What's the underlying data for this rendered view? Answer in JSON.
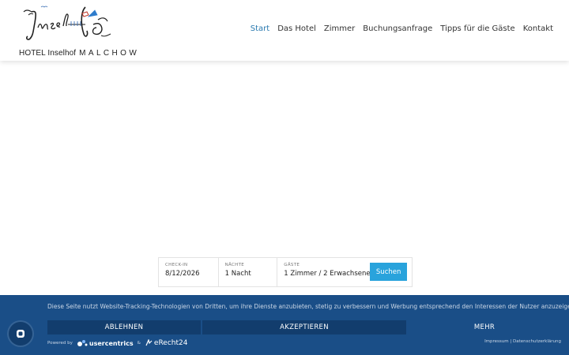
{
  "logo": {
    "script_text": "Inselhof",
    "hotel_name": "HOTEL Inselhof",
    "town": "MALCHOW"
  },
  "nav": {
    "items": [
      "Start",
      "Das Hotel",
      "Zimmer",
      "Buchungsanfrage",
      "Tipps für die Gäste",
      "Kontakt"
    ],
    "active": "Start"
  },
  "booking": {
    "checkin_label": "CHECK-IN",
    "checkin_value": "8/12/2026",
    "nights_label": "NÄCHTE",
    "nights_value": "1 Nacht",
    "guests_label": "GÄSTE",
    "guests_value": "1 Zimmer / 2 Erwachsene",
    "search_label": "Suchen"
  },
  "consent": {
    "message": "Diese Seite nutzt Website-Tracking-Technologien von Dritten, um ihre Dienste anzubieten, stetig zu verbessern und Werbung entsprechend den Interessen der Nutzer anzuzeigen.",
    "decline_label": "ABLEHNEN",
    "accept_label": "AKZEPTIEREN",
    "more_label": "MEHR",
    "powered_by": "Powered by",
    "usercentrics": "usercentrics",
    "ampersand": "&",
    "erecht": "eRecht24",
    "impressum": "Impressum",
    "separator": "|",
    "privacy": "Datenschutzerklärung"
  },
  "colors": {
    "accent": "#2a7ab0",
    "search_button": "#29a3dc",
    "banner": "#1a4e87",
    "banner_button": "#123d6d"
  },
  "icons": {
    "privacy_fab": "fingerprint-shield-icon",
    "usercentrics_logo": "usercentrics-logo-icon",
    "erecht_logo": "erecht24-logo-icon"
  }
}
